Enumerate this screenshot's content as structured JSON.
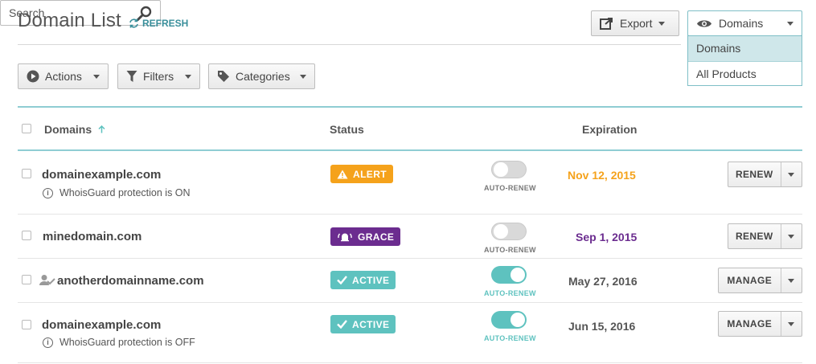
{
  "header": {
    "title": "Domain List",
    "refresh_label": "REFRESH",
    "export_label": "Export",
    "view_select": "Domains",
    "view_options": [
      "Domains",
      "All Products"
    ]
  },
  "toolbar": {
    "actions_label": "Actions",
    "filters_label": "Filters",
    "categories_label": "Categories",
    "search_placeholder": "Search"
  },
  "table": {
    "columns": {
      "domains": "Domains",
      "status": "Status",
      "expiration": "Expiration"
    },
    "auto_renew_label": "AUTO-RENEW",
    "rows": [
      {
        "domain": "domainexample.com",
        "note": "WhoisGuard protection is ON",
        "status": "ALERT",
        "auto_renew": false,
        "expiration": "Nov 12, 2015",
        "action": "RENEW"
      },
      {
        "domain": "minedomain.com",
        "note": "",
        "status": "GRACE",
        "auto_renew": false,
        "expiration": "Sep 1, 2015",
        "action": "RENEW"
      },
      {
        "domain": "anotherdomainname.com",
        "note": "",
        "status": "ACTIVE",
        "auto_renew": true,
        "expiration": "May 27, 2016",
        "action": "MANAGE"
      },
      {
        "domain": "domainexample.com",
        "note": "WhoisGuard protection is OFF",
        "status": "ACTIVE",
        "auto_renew": true,
        "expiration": "Jun 15, 2016",
        "action": "MANAGE"
      }
    ]
  },
  "colors": {
    "alert": "#f5a21b",
    "grace": "#6b2c8f",
    "active": "#5ec2bf",
    "teal": "#8fcdd3"
  }
}
